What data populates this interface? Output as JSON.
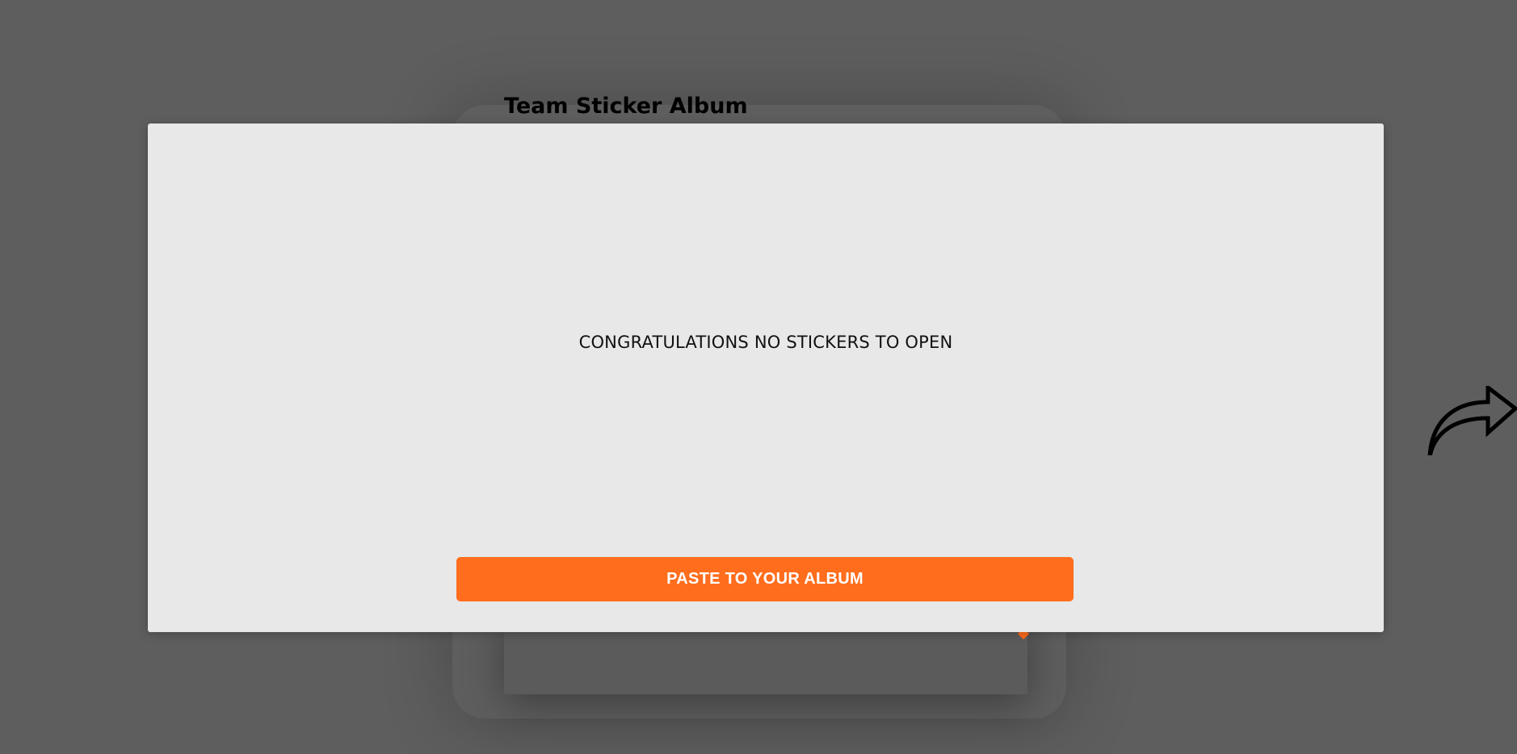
{
  "page": {
    "title": "Team Sticker Album"
  },
  "modal": {
    "message": "CONGRATULATIONS NO STICKERS TO OPEN",
    "paste_button_label": "PASTE TO YOUR ALBUM"
  },
  "share": {
    "icon": "share-arrow-icon"
  },
  "colors": {
    "overlay_background": "#5e5e5e",
    "modal_background": "#e8e8e8",
    "accent": "#ff6d1d",
    "button_text": "#ffffff"
  }
}
